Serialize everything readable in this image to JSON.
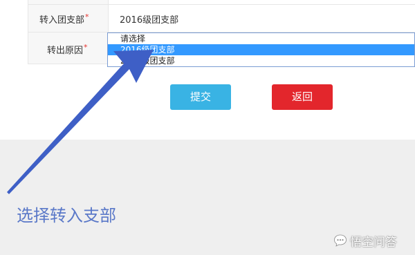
{
  "form": {
    "row1": {
      "label": "转入团支部",
      "required_mark": "*",
      "value": "2016级团支部"
    },
    "row2": {
      "label": "转出原因",
      "required_mark": "*"
    },
    "dropdown": {
      "options": [
        {
          "label": "请选择",
          "selected": false
        },
        {
          "label": "2016级团支部",
          "selected": true
        },
        {
          "label": "2017级团支部",
          "selected": false
        }
      ]
    },
    "buttons": {
      "submit_label": "提交",
      "back_label": "返回"
    }
  },
  "annotation": {
    "text": "选择转入支部"
  },
  "watermark": {
    "text": "悟空问答",
    "icon": "speech-bubble-icon"
  },
  "colors": {
    "submit_button": "#39b3e4",
    "back_button": "#e3262c",
    "selected_option": "#3399ff",
    "annotation": "#5a78c8",
    "arrow": "#3e5fc6"
  }
}
